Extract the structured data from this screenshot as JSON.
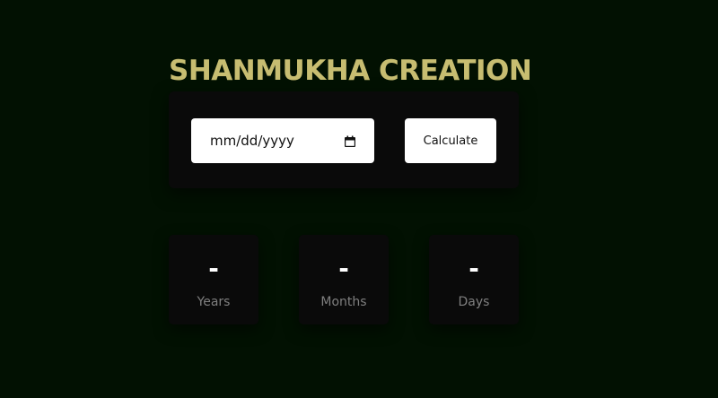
{
  "app": {
    "title": "SHANMUKHA CREATION"
  },
  "form": {
    "date_placeholder": "mm/dd/yyyy",
    "calculate_label": "Calculate"
  },
  "results": [
    {
      "value": "-",
      "label": "Years"
    },
    {
      "value": "-",
      "label": "Months"
    },
    {
      "value": "-",
      "label": "Days"
    }
  ],
  "colors": {
    "background": "#021102",
    "title": "#c7bd71",
    "panel": "#0a0a0a"
  }
}
